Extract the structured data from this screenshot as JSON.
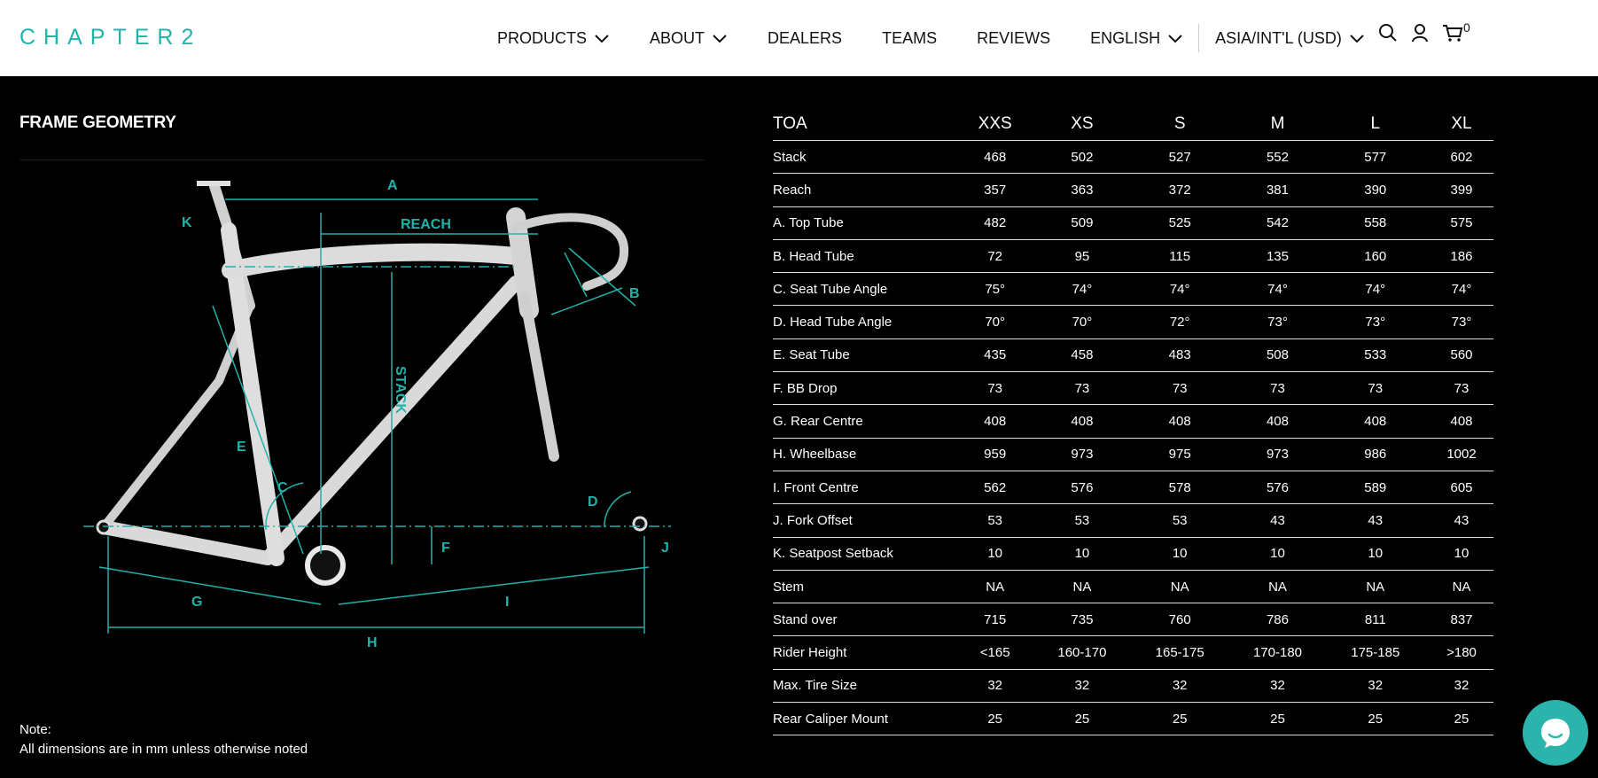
{
  "brand": {
    "logo_text": "CHAPTER2",
    "accent_color": "#1fb3aa"
  },
  "nav": {
    "items": [
      {
        "label": "PRODUCTS",
        "dropdown": true
      },
      {
        "label": "ABOUT",
        "dropdown": true
      },
      {
        "label": "DEALERS",
        "dropdown": false
      },
      {
        "label": "TEAMS",
        "dropdown": false
      },
      {
        "label": "REVIEWS",
        "dropdown": false
      },
      {
        "label": "ENGLISH",
        "dropdown": true
      },
      {
        "label": "ASIA/INT'L (USD)",
        "dropdown": true
      }
    ],
    "icons": [
      "search-icon",
      "account-icon",
      "cart-icon"
    ],
    "cart_count": "0"
  },
  "geometry": {
    "section_title": "FRAME GEOMETRY",
    "diagram_labels": {
      "a": "A",
      "reach": "REACH",
      "k": "K",
      "b": "B",
      "stack": "STACK",
      "e": "E",
      "c": "C",
      "d": "D",
      "f": "F",
      "j": "J",
      "g": "G",
      "i": "I",
      "h": "H"
    },
    "note_title": "Note:",
    "note_text": "All dimensions are in mm unless otherwise noted"
  },
  "table": {
    "headers": [
      "TOA",
      "XXS",
      "XS",
      "S",
      "M",
      "L",
      "XL"
    ],
    "rows": [
      [
        "Stack",
        "468",
        "502",
        "527",
        "552",
        "577",
        "602"
      ],
      [
        "Reach",
        "357",
        "363",
        "372",
        "381",
        "390",
        "399"
      ],
      [
        "A. Top Tube",
        "482",
        "509",
        "525",
        "542",
        "558",
        "575"
      ],
      [
        "B. Head Tube",
        "72",
        "95",
        "115",
        "135",
        "160",
        "186"
      ],
      [
        "C. Seat Tube Angle",
        "75°",
        "74°",
        "74°",
        "74°",
        "74°",
        "74°"
      ],
      [
        "D. Head Tube Angle",
        "70°",
        "70°",
        "72°",
        "73°",
        "73°",
        "73°"
      ],
      [
        "E. Seat Tube",
        "435",
        "458",
        "483",
        "508",
        "533",
        "560"
      ],
      [
        "F. BB Drop",
        "73",
        "73",
        "73",
        "73",
        "73",
        "73"
      ],
      [
        "G. Rear Centre",
        "408",
        "408",
        "408",
        "408",
        "408",
        "408"
      ],
      [
        "H. Wheelbase",
        "959",
        "973",
        "975",
        "973",
        "986",
        "1002"
      ],
      [
        "I. Front Centre",
        "562",
        "576",
        "578",
        "576",
        "589",
        "605"
      ],
      [
        "J. Fork Offset",
        "53",
        "53",
        "53",
        "43",
        "43",
        "43"
      ],
      [
        "K. Seatpost Setback",
        "10",
        "10",
        "10",
        "10",
        "10",
        "10"
      ],
      [
        "Stem",
        "NA",
        "NA",
        "NA",
        "NA",
        "NA",
        "NA"
      ],
      [
        "Stand over",
        "715",
        "735",
        "760",
        "786",
        "811",
        "837"
      ],
      [
        "Rider Height",
        "<165",
        "160-170",
        "165-175",
        "170-180",
        "175-185",
        ">180"
      ],
      [
        "Max. Tire Size",
        "32",
        "32",
        "32",
        "32",
        "32",
        "32"
      ],
      [
        "Rear Caliper Mount",
        "25",
        "25",
        "25",
        "25",
        "25",
        "25"
      ]
    ]
  },
  "chat": {
    "icon": "chat-bubble-icon",
    "color": "#2bb4ac"
  }
}
